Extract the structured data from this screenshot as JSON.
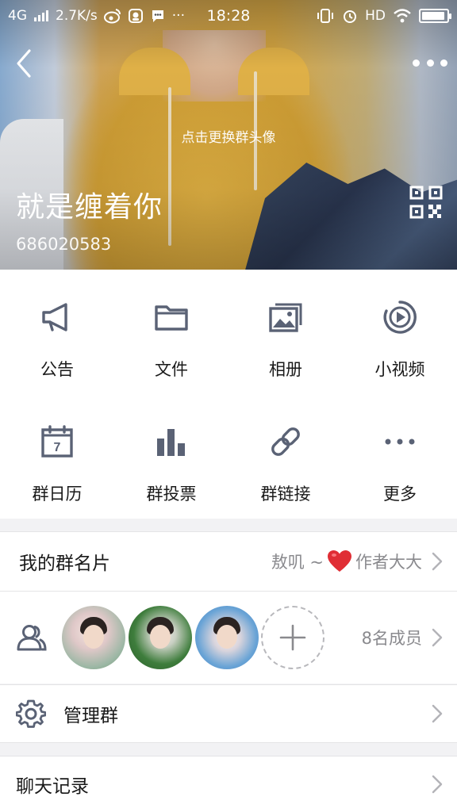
{
  "status_bar": {
    "network": "4G",
    "speed": "2.7K/s",
    "time": "18:28",
    "hd": "HD",
    "more_dots": "···",
    "battery_level": 0.95
  },
  "header": {
    "change_avatar_hint": "点击更换群头像",
    "group_name": "就是缠着你",
    "group_id": "686020583",
    "back_icon": "chevron-left-icon",
    "more_icon": "more-dots-icon",
    "qr_icon": "qr-code-icon"
  },
  "features": [
    {
      "label": "公告",
      "icon": "megaphone-icon"
    },
    {
      "label": "文件",
      "icon": "folder-icon"
    },
    {
      "label": "相册",
      "icon": "album-icon"
    },
    {
      "label": "小视频",
      "icon": "video-icon"
    },
    {
      "label": "群日历",
      "icon": "calendar-icon",
      "badge": "7"
    },
    {
      "label": "群投票",
      "icon": "bar-chart-icon"
    },
    {
      "label": "群链接",
      "icon": "link-icon"
    },
    {
      "label": "更多",
      "icon": "more-dots-icon"
    }
  ],
  "my_card": {
    "title": "我的群名片",
    "value_before": "敖叽 ~",
    "value_after": "作者大大",
    "emoji": "❤️"
  },
  "members": {
    "count_label": "8名成员",
    "add_symbol": "+"
  },
  "manage": {
    "title": "管理群"
  },
  "history": {
    "title": "聊天记录"
  },
  "colors": {
    "icon_gray": "#5a6275",
    "text_primary": "#1a1a1a",
    "text_secondary": "#8a8a8e",
    "heart": "#e02e35"
  }
}
